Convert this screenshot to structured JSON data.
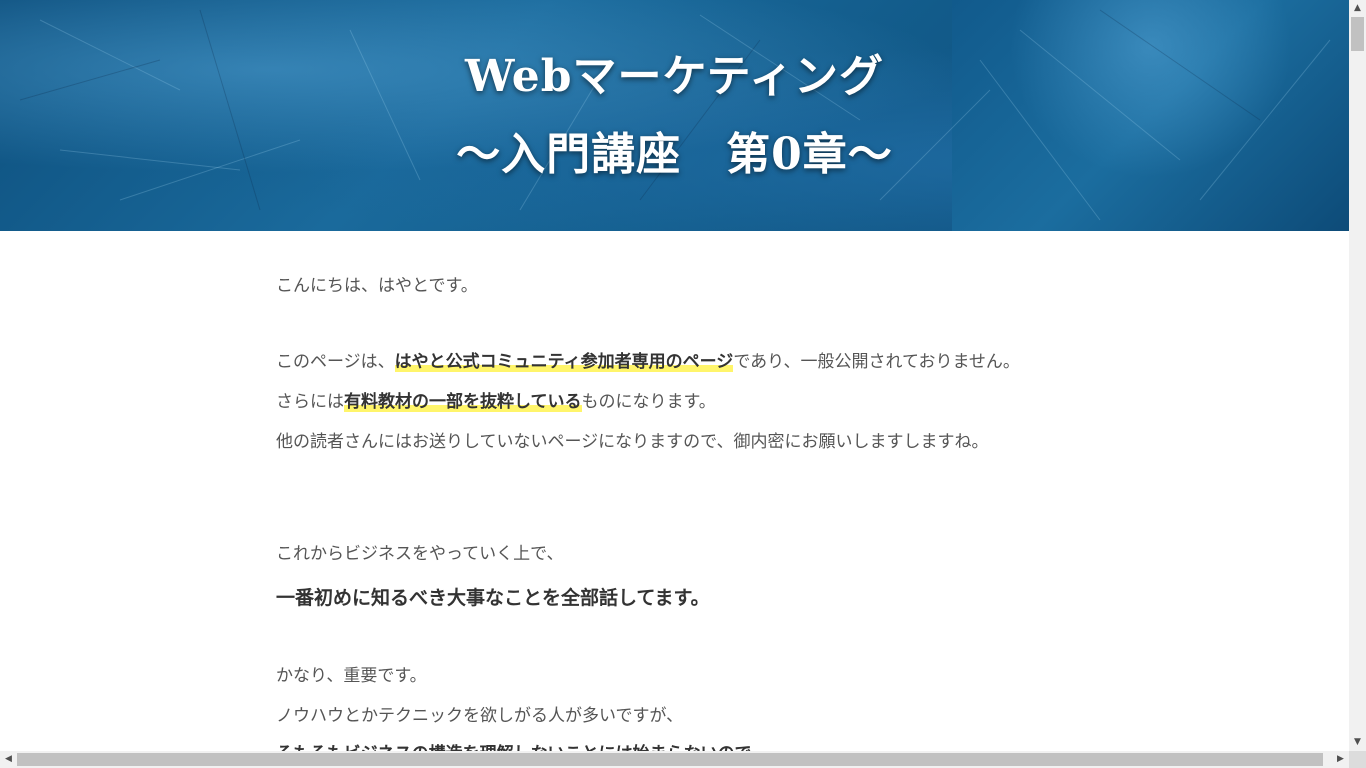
{
  "hero": {
    "title_line1": "Webマーケティング",
    "title_line2": "〜入門講座　第0章〜"
  },
  "article": {
    "greeting": "こんにちは、はやとです。",
    "p2_prefix": "このページは、",
    "p2_highlight": "はやと公式コミュニティ参加者専用のページ",
    "p2_suffix": "であり、一般公開されておりません。",
    "p3_prefix": "さらには",
    "p3_highlight": "有料教材の一部を抜粋している",
    "p3_suffix": "ものになります。",
    "p4": "他の読者さんにはお送りしていないページになりますので、御内密にお願いしますしますね。",
    "p5": "これからビジネスをやっていく上で、",
    "p6_bold": "一番初めに知るべき大事なことを全部話してます。",
    "p7": "かなり、重要です。",
    "p8": "ノウハウとかテクニックを欲しがる人が多いですが、",
    "p9_bold_partial": "そもそもビジネスの構造を理解しないことには始まらないので"
  },
  "colors": {
    "highlight": "#fff56b",
    "hero_blue": "#1a6a9c"
  },
  "scrollbars": {
    "up_icon": "▲",
    "down_icon": "▼",
    "left_icon": "◀",
    "right_icon": "▶"
  }
}
